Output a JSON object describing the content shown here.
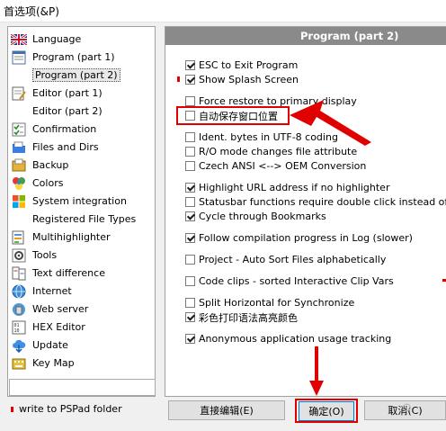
{
  "window": {
    "title": "首选项(&P)"
  },
  "sidebar": {
    "items": [
      {
        "label": "Language",
        "icon": "uk-flag-icon"
      },
      {
        "label": "Program  (part 1)",
        "icon": "document-icon"
      },
      {
        "label": "Program  (part 2)",
        "icon": "blank",
        "selected": true
      },
      {
        "label": "Editor  (part 1)",
        "icon": "edit-document-icon"
      },
      {
        "label": "Editor  (part 2)",
        "icon": "blank"
      },
      {
        "label": "Confirmation",
        "icon": "checklist-icon"
      },
      {
        "label": "Files and Dirs",
        "icon": "folder-icon"
      },
      {
        "label": "Backup",
        "icon": "backup-icon"
      },
      {
        "label": "Colors",
        "icon": "palette-icon"
      },
      {
        "label": "System integration",
        "icon": "windows-logo-icon"
      },
      {
        "label": "Registered File Types",
        "icon": "blank"
      },
      {
        "label": "Multihighlighter",
        "icon": "multihighlighter-icon"
      },
      {
        "label": "Tools",
        "icon": "gear-icon"
      },
      {
        "label": "Text difference",
        "icon": "text-diff-icon"
      },
      {
        "label": "Internet",
        "icon": "globe-icon"
      },
      {
        "label": "Web server",
        "icon": "web-server-icon"
      },
      {
        "label": "HEX Editor",
        "icon": "hex-icon"
      },
      {
        "label": "Update",
        "icon": "cloud-download-icon"
      },
      {
        "label": "Key Map",
        "icon": "keyboard-icon"
      }
    ],
    "search_value": "",
    "write_to_folder": "write to PSPad folder"
  },
  "panel": {
    "header": "Program  (part 2)",
    "options": [
      {
        "label": "ESC to Exit Program",
        "checked": true
      },
      {
        "label": "Show Splash Screen",
        "checked": true
      },
      {
        "label": "Force restore to primary display",
        "checked": false
      },
      {
        "label": "自动保存窗口位置",
        "checked": false
      },
      {
        "label": "Ident. bytes in UTF-8 coding",
        "checked": false
      },
      {
        "label": "R/O mode changes file attribute",
        "checked": false
      },
      {
        "label": "Czech ANSI <--> OEM Conversion",
        "checked": false
      },
      {
        "label": "Highlight URL address if no highlighter",
        "checked": true
      },
      {
        "label": "Statusbar functions require double click instead of single c",
        "checked": false
      },
      {
        "label": "Cycle through Bookmarks",
        "checked": true
      },
      {
        "label": "Follow compilation progress in Log (slower)",
        "checked": true
      },
      {
        "label": "Project - Auto Sort Files alphabetically",
        "checked": false
      },
      {
        "label": "Code clips - sorted Interactive Clip Vars",
        "checked": false
      },
      {
        "label": "Split Horizontal for Synchronize",
        "checked": false
      },
      {
        "label": "彩色打印语法高亮颜色",
        "checked": true
      },
      {
        "label": "Anonymous application usage tracking",
        "checked": true
      }
    ]
  },
  "buttons": {
    "direct_edit": "直接编辑(E)",
    "ok": "确定(O)",
    "cancel": "取消(C)"
  },
  "colors": {
    "annotation_red": "#e00000",
    "header_gray": "#8a8a8a",
    "default_button_border": "#0078d7"
  }
}
